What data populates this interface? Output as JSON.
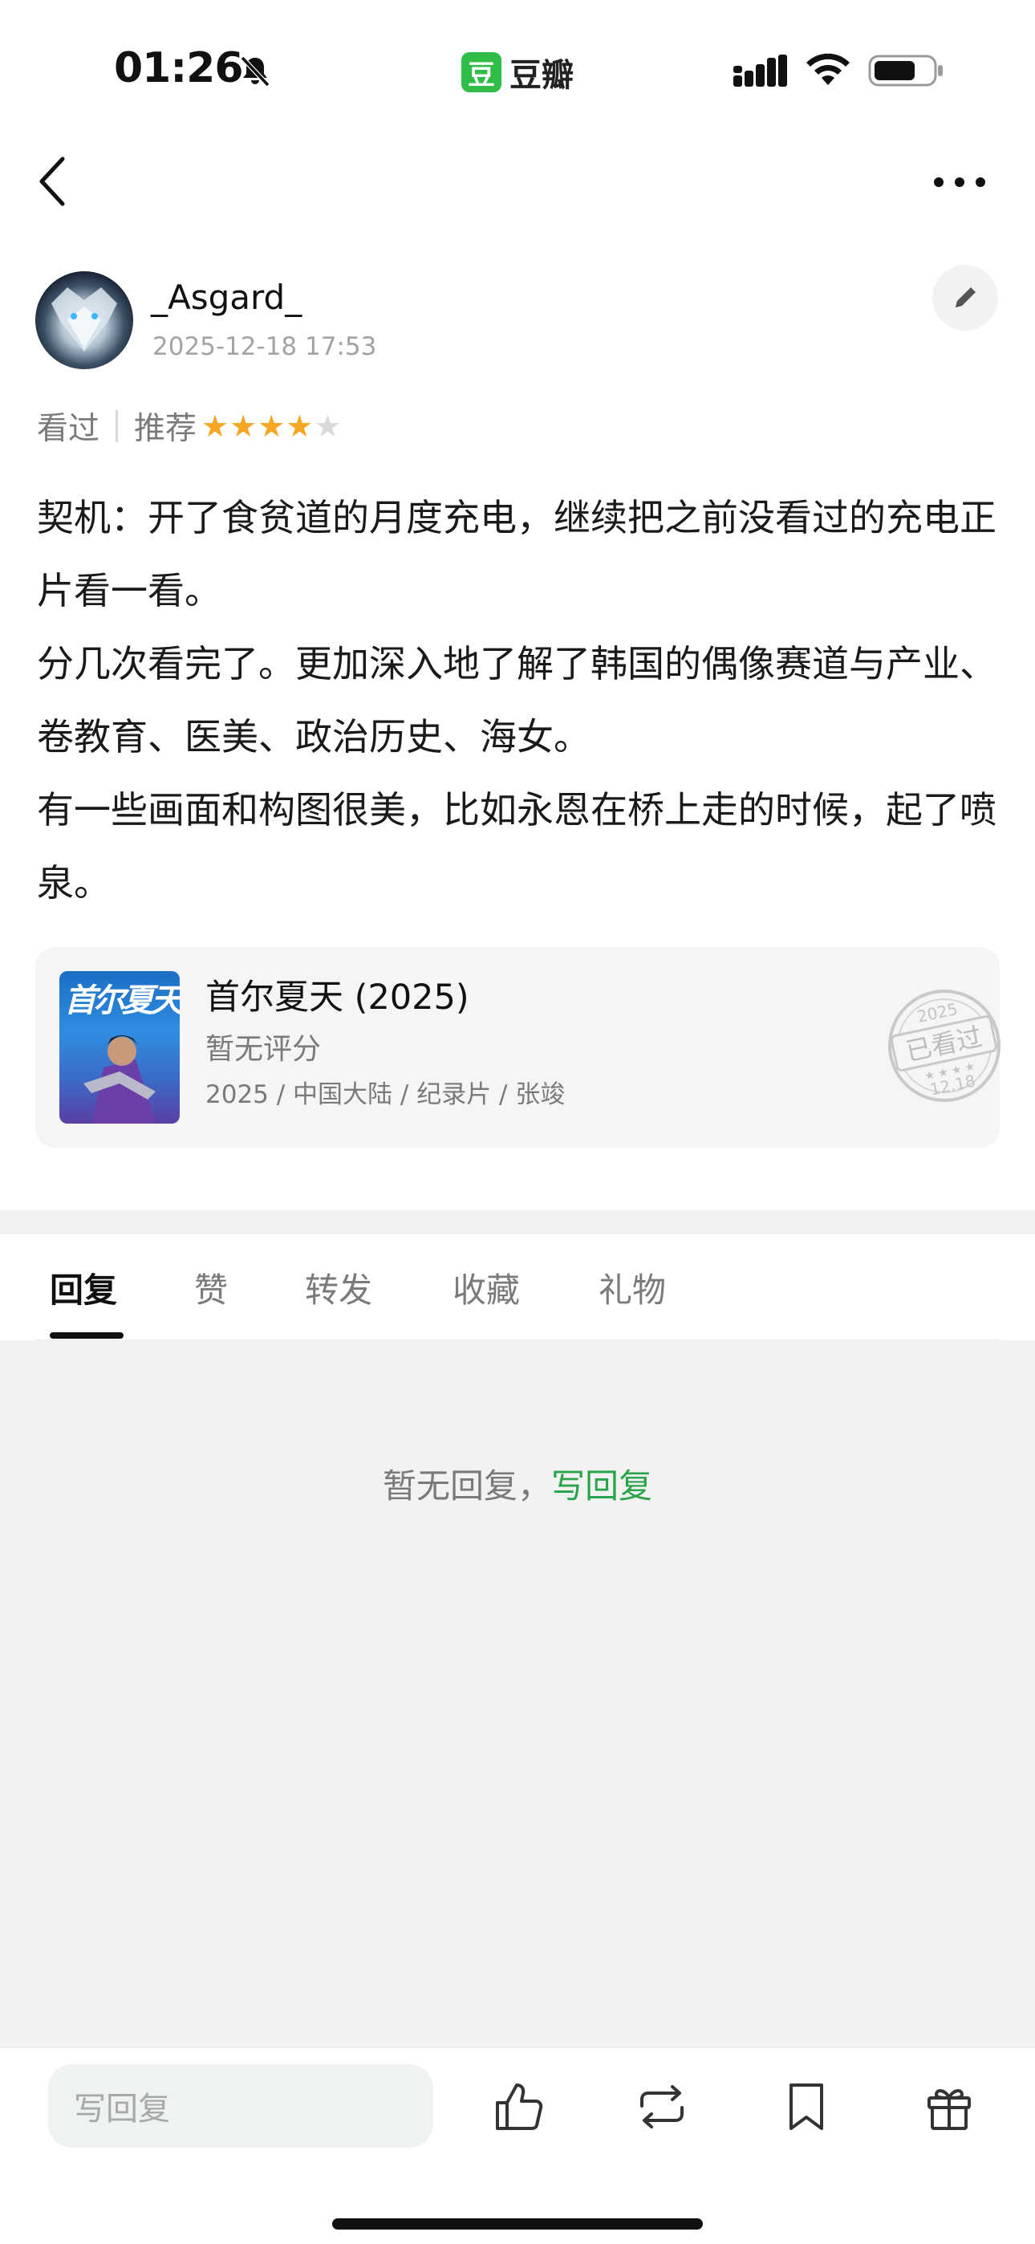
{
  "status_bar": {
    "time": "01:26",
    "app_logo_char": "豆",
    "app_name": "豆瓣"
  },
  "user": {
    "name": "_Asgard_",
    "timestamp": "2025-12-18 17:53"
  },
  "rating": {
    "status": "看过",
    "label": "推荐",
    "stars_filled": 4,
    "stars_total": 5,
    "star_color": "#f5a623",
    "star_empty_color": "#d9d9d9"
  },
  "review": {
    "paragraphs": [
      "契机：开了食贫道的月度充电，继续把之前没看过的充电正片看一看。",
      "分几次看完了。更加深入地了解了韩国的偶像赛道与产业、卷教育、医美、政治历史、海女。",
      "有一些画面和构图很美，比如永恩在桥上走的时候，起了喷泉。"
    ]
  },
  "movie": {
    "title": "首尔夏天 (2025)",
    "rating_text": "暂无评分",
    "meta": "2025 / 中国大陆 / 纪录片 / 张竣",
    "poster_text": "首尔夏天",
    "stamp": {
      "year": "2025",
      "label": "已看过",
      "date": "12.18"
    }
  },
  "tabs": [
    {
      "label": "回复",
      "active": true
    },
    {
      "label": "赞",
      "active": false
    },
    {
      "label": "转发",
      "active": false
    },
    {
      "label": "收藏",
      "active": false
    },
    {
      "label": "礼物",
      "active": false
    }
  ],
  "replies": {
    "empty_text": "暂无回复，",
    "write_link": "写回复"
  },
  "bottom_bar": {
    "reply_placeholder": "写回复",
    "icons": [
      "like-icon",
      "repost-icon",
      "bookmark-icon",
      "gift-icon"
    ]
  },
  "colors": {
    "accent_green": "#2aa44a",
    "brand_green": "#2fbd47"
  }
}
